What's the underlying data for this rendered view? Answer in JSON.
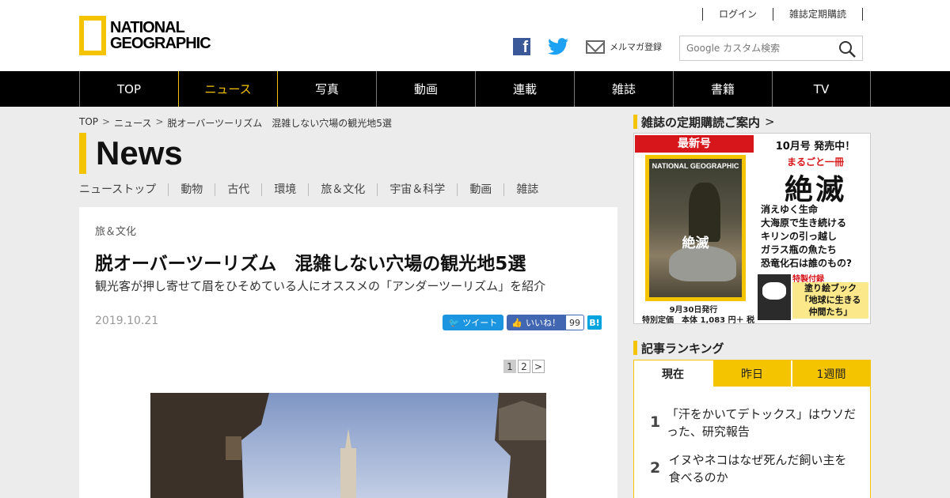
{
  "header": {
    "logo_line1": "NATIONAL",
    "logo_line2": "GEOGRAPHIC",
    "top_links": [
      "ログイン",
      "雑誌定期購読"
    ],
    "mail_label": "メルマガ登録",
    "search_placeholder": "Google カスタム検索",
    "icons": [
      "facebook-icon",
      "twitter-icon",
      "mail-icon",
      "search-icon"
    ],
    "accent_color": "#f5c400"
  },
  "nav": {
    "items": [
      "TOP",
      "ニュース",
      "写真",
      "動画",
      "連載",
      "雑誌",
      "書籍",
      "TV"
    ],
    "active": "ニュース"
  },
  "breadcrumb": [
    "TOP",
    "ニュース",
    "脱オーバーツーリズム　混雑しない穴場の観光地5選"
  ],
  "section_title": "News",
  "subnav": [
    "ニューストップ",
    "動物",
    "古代",
    "環境",
    "旅＆文化",
    "宇宙＆科学",
    "動画",
    "雑誌"
  ],
  "article": {
    "category": "旅＆文化",
    "title": "脱オーバーツーリズム　混雑しない穴場の観光地5選",
    "subtitle": "観光客が押し寄せて眉をひそめている人にオススメの「アンダーツーリズム」を紹介",
    "date": "2019.10.21",
    "tweet_label": "ツイート",
    "like_label": "いいね！",
    "like_count": "99",
    "hatena_label": "B!",
    "pager": [
      "1",
      "2",
      ">"
    ],
    "pager_current": "1"
  },
  "sidebar": {
    "subscription_title": "雑誌の定期購読ご案内",
    "magazine": {
      "latest_label": "最新号",
      "issue": "10月号 発売中！",
      "tagline": "まるごと一冊",
      "feature": "絶滅",
      "cover_brand": "NATIONAL GEOGRAPHIC",
      "cover_title": "絶滅",
      "toc": [
        "消えゆく生命",
        "大海原で生き続ける",
        "キリンの引っ越し",
        "ガラス瓶の魚たち",
        "恐竜化石は誰のもの?"
      ],
      "appendix_label": "特製付録",
      "appendix": [
        "塗り絵ブック",
        "「地球に生きる",
        "仲間たち」"
      ],
      "release_date": "9月30日発行",
      "price": "特別定価　本体 1,083 円＋ 税"
    },
    "ranking_title": "記事ランキング",
    "ranking_tabs": [
      "現在",
      "昨日",
      "1週間"
    ],
    "ranking_items": [
      {
        "rank": "1",
        "title": "「汗をかいてデトックス」はウソだった、研究報告"
      },
      {
        "rank": "2",
        "title": "イヌやネコはなぜ死んだ飼い主を食べるのか"
      }
    ]
  }
}
